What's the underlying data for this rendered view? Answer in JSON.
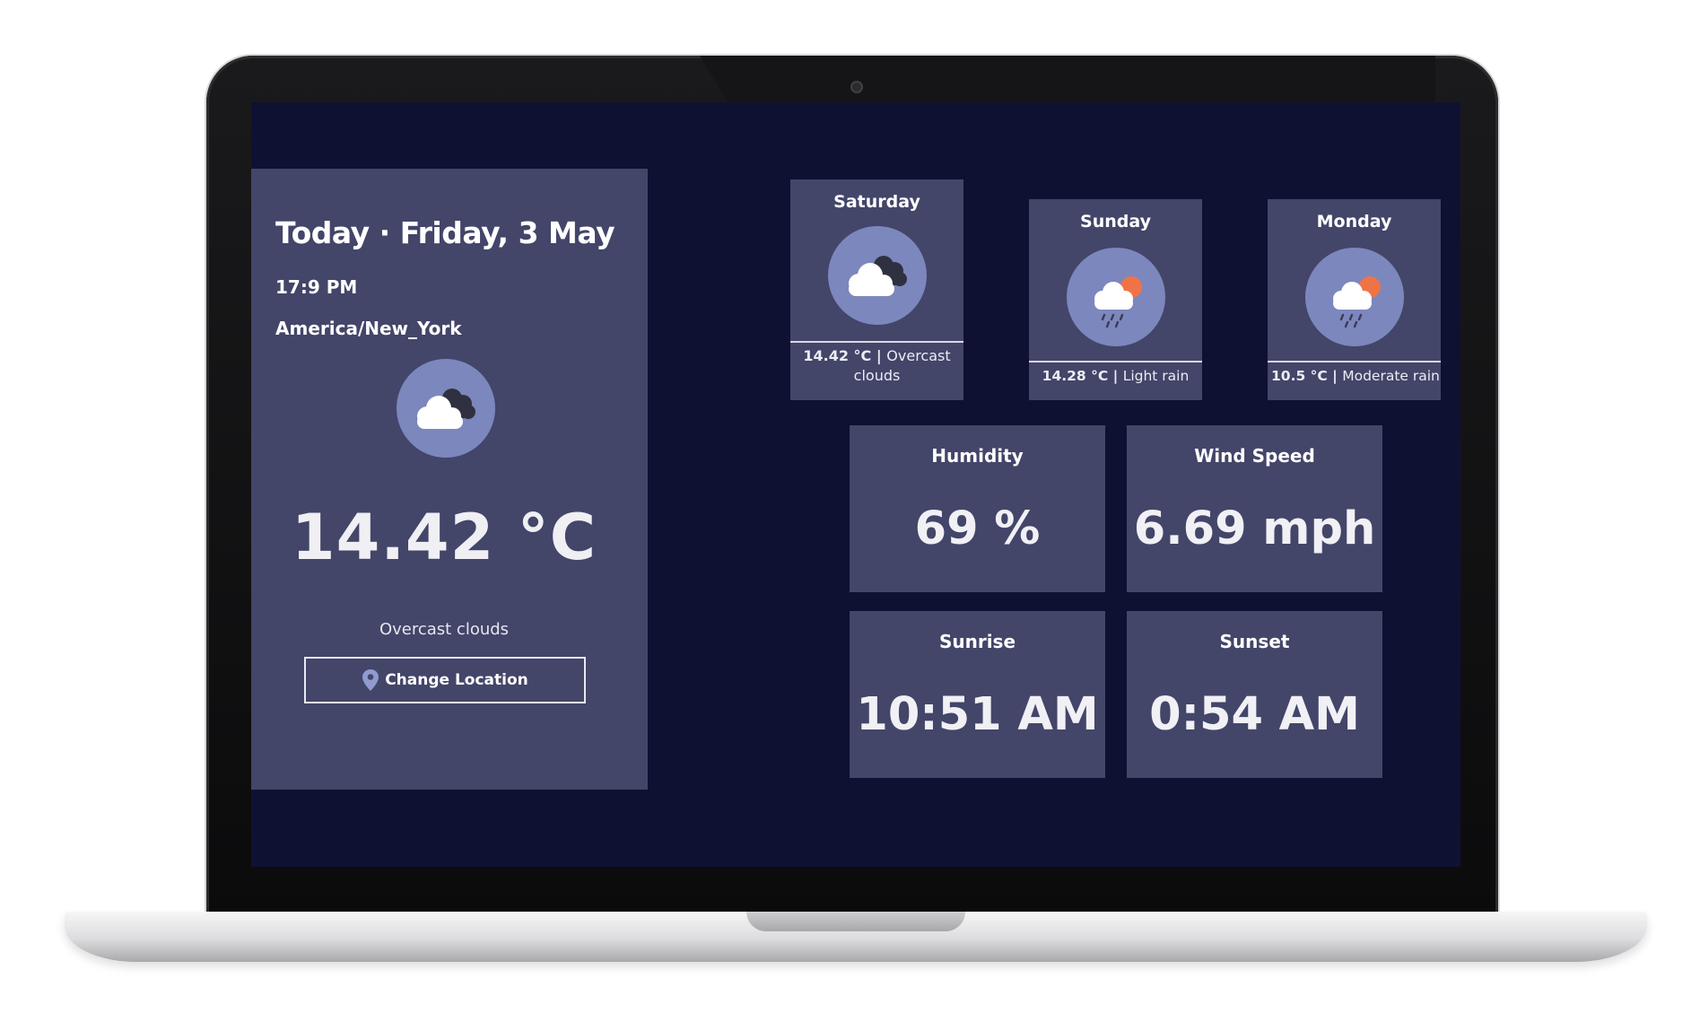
{
  "today": {
    "title": "Today · Friday, 3 May",
    "time": "17:9 PM",
    "location": "America/New_York",
    "icon": "overcast-clouds-icon",
    "temperature": "14.42 °C",
    "condition": "Overcast clouds",
    "change_location_label": "Change Location"
  },
  "forecast": [
    {
      "day": "Saturday",
      "icon": "overcast-clouds-icon",
      "temp": "14.42 °C",
      "sep": " | ",
      "desc": "Overcast clouds"
    },
    {
      "day": "Sunday",
      "icon": "light-rain-icon",
      "temp": "14.28 °C",
      "sep": " | ",
      "desc": "Light rain"
    },
    {
      "day": "Monday",
      "icon": "moderate-rain-icon",
      "temp": "10.5 °C",
      "sep": " | ",
      "desc": "Moderate rain"
    }
  ],
  "stats": {
    "humidity": {
      "label": "Humidity",
      "value": "69 %"
    },
    "wind": {
      "label": "Wind Speed",
      "value": "6.69 mph"
    },
    "sunrise": {
      "label": "Sunrise",
      "value": "10:51 AM"
    },
    "sunset": {
      "label": "Sunset",
      "value": "0:54 AM"
    }
  },
  "colors": {
    "screen_background": "#0f1133",
    "card_background": "#434569",
    "icon_circle": "#7c87bd",
    "sun": "#f07346"
  }
}
